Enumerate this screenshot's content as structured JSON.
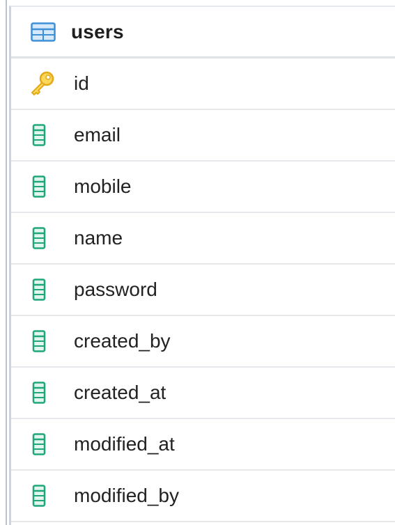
{
  "table": {
    "name": "users",
    "columns": [
      {
        "name": "id",
        "icon": "primary-key-icon",
        "primary_key": true
      },
      {
        "name": "email",
        "icon": "column-icon",
        "primary_key": false
      },
      {
        "name": "mobile",
        "icon": "column-icon",
        "primary_key": false
      },
      {
        "name": "name",
        "icon": "column-icon",
        "primary_key": false
      },
      {
        "name": "password",
        "icon": "column-icon",
        "primary_key": false
      },
      {
        "name": "created_by",
        "icon": "column-icon",
        "primary_key": false
      },
      {
        "name": "created_at",
        "icon": "column-icon",
        "primary_key": false
      },
      {
        "name": "modified_at",
        "icon": "column-icon",
        "primary_key": false
      },
      {
        "name": "modified_by",
        "icon": "column-icon",
        "primary_key": false
      }
    ]
  },
  "colors": {
    "table_icon": "#3d8fd6",
    "table_icon_fill": "#d6e9fb",
    "column_icon": "#1fa67a",
    "column_icon_fill": "#e2f6ee",
    "key_icon": "#e6a817",
    "key_icon_fill": "#f9d85a"
  }
}
